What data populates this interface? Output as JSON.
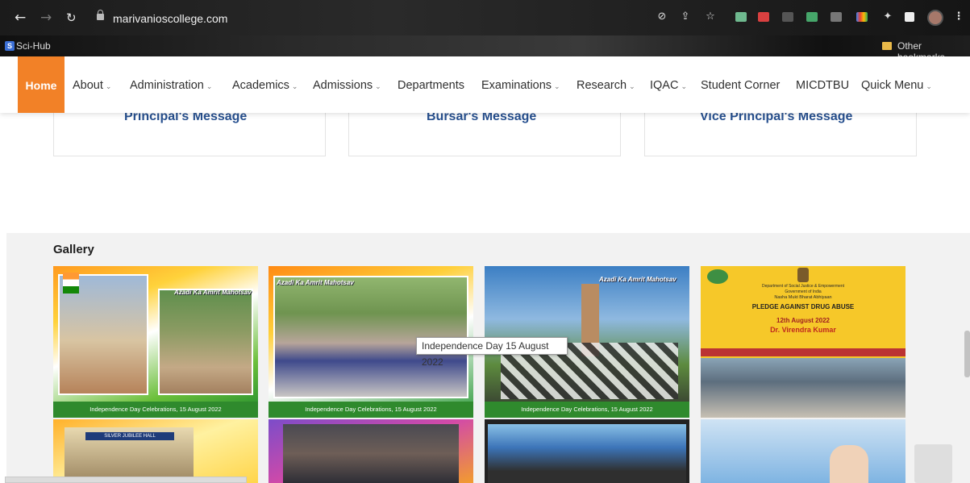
{
  "browser": {
    "url": "marivanioscollege.com",
    "bookmarks": [
      {
        "label": "Sci-Hub"
      },
      {
        "label": "Other bookmarks"
      }
    ]
  },
  "nav": {
    "home": "Home",
    "items": [
      {
        "label": "About",
        "dropdown": true
      },
      {
        "label": "Administration",
        "dropdown": true
      },
      {
        "label": "Academics",
        "dropdown": true
      },
      {
        "label": "Admissions",
        "dropdown": true
      },
      {
        "label": "Departments",
        "dropdown": false
      },
      {
        "label": "Examinations",
        "dropdown": true
      },
      {
        "label": "Research",
        "dropdown": true
      },
      {
        "label": "IQAC",
        "dropdown": true
      },
      {
        "label": "Student Corner",
        "dropdown": false
      },
      {
        "label": "MICDTBU",
        "dropdown": false
      },
      {
        "label": "Quick Menu",
        "dropdown": true
      }
    ],
    "caret": "⌄"
  },
  "cards": [
    {
      "title": "Principal's Message"
    },
    {
      "title": "Bursar's Message"
    },
    {
      "title": "Vice Principal's Message"
    }
  ],
  "gallery": {
    "title": "Gallery",
    "tooltip": "Independence Day 15 August 2022",
    "tiles": [
      {
        "caption": "Independence Day Celebrations, 15 August 2022",
        "banner": "Azadi Ka Amrit Mahotsav"
      },
      {
        "caption": "Independence Day Celebrations, 15 August 2022",
        "banner": "Azadi Ka Amrit Mahotsav"
      },
      {
        "caption": "Independence Day Celebrations, 15 August 2022",
        "banner": "Azadi Ka Amrit Mahotsav"
      },
      {
        "caption": "",
        "banner": ""
      }
    ],
    "poster": {
      "line1": "Department of Social Justice & Empowerment",
      "line2": "Government of India",
      "line3": "Nasha Mukt Bharat Abhiyaan",
      "headline": "PLEDGE AGAINST DRUG ABUSE",
      "date": "12th August 2022",
      "name": "Dr. Virendra Kumar",
      "bottom_banner": "Silver Jubilee Hall"
    }
  },
  "colors": {
    "accent": "#f28127",
    "card_title": "#27508f",
    "caption_strip": "#2f8a2d"
  }
}
